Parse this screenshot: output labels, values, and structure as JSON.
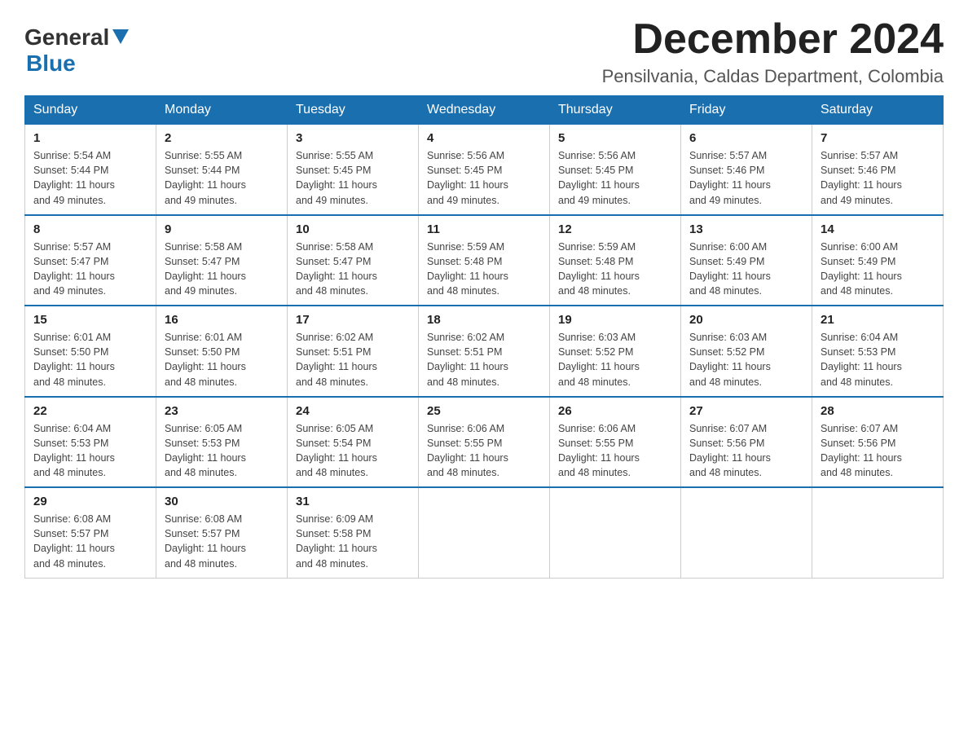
{
  "header": {
    "logo_general": "General",
    "logo_blue": "Blue",
    "title": "December 2024",
    "subtitle": "Pensilvania, Caldas Department, Colombia"
  },
  "days_of_week": [
    "Sunday",
    "Monday",
    "Tuesday",
    "Wednesday",
    "Thursday",
    "Friday",
    "Saturday"
  ],
  "weeks": [
    [
      {
        "day": "1",
        "sunrise": "5:54 AM",
        "sunset": "5:44 PM",
        "daylight": "11 hours and 49 minutes."
      },
      {
        "day": "2",
        "sunrise": "5:55 AM",
        "sunset": "5:44 PM",
        "daylight": "11 hours and 49 minutes."
      },
      {
        "day": "3",
        "sunrise": "5:55 AM",
        "sunset": "5:45 PM",
        "daylight": "11 hours and 49 minutes."
      },
      {
        "day": "4",
        "sunrise": "5:56 AM",
        "sunset": "5:45 PM",
        "daylight": "11 hours and 49 minutes."
      },
      {
        "day": "5",
        "sunrise": "5:56 AM",
        "sunset": "5:45 PM",
        "daylight": "11 hours and 49 minutes."
      },
      {
        "day": "6",
        "sunrise": "5:57 AM",
        "sunset": "5:46 PM",
        "daylight": "11 hours and 49 minutes."
      },
      {
        "day": "7",
        "sunrise": "5:57 AM",
        "sunset": "5:46 PM",
        "daylight": "11 hours and 49 minutes."
      }
    ],
    [
      {
        "day": "8",
        "sunrise": "5:57 AM",
        "sunset": "5:47 PM",
        "daylight": "11 hours and 49 minutes."
      },
      {
        "day": "9",
        "sunrise": "5:58 AM",
        "sunset": "5:47 PM",
        "daylight": "11 hours and 49 minutes."
      },
      {
        "day": "10",
        "sunrise": "5:58 AM",
        "sunset": "5:47 PM",
        "daylight": "11 hours and 48 minutes."
      },
      {
        "day": "11",
        "sunrise": "5:59 AM",
        "sunset": "5:48 PM",
        "daylight": "11 hours and 48 minutes."
      },
      {
        "day": "12",
        "sunrise": "5:59 AM",
        "sunset": "5:48 PM",
        "daylight": "11 hours and 48 minutes."
      },
      {
        "day": "13",
        "sunrise": "6:00 AM",
        "sunset": "5:49 PM",
        "daylight": "11 hours and 48 minutes."
      },
      {
        "day": "14",
        "sunrise": "6:00 AM",
        "sunset": "5:49 PM",
        "daylight": "11 hours and 48 minutes."
      }
    ],
    [
      {
        "day": "15",
        "sunrise": "6:01 AM",
        "sunset": "5:50 PM",
        "daylight": "11 hours and 48 minutes."
      },
      {
        "day": "16",
        "sunrise": "6:01 AM",
        "sunset": "5:50 PM",
        "daylight": "11 hours and 48 minutes."
      },
      {
        "day": "17",
        "sunrise": "6:02 AM",
        "sunset": "5:51 PM",
        "daylight": "11 hours and 48 minutes."
      },
      {
        "day": "18",
        "sunrise": "6:02 AM",
        "sunset": "5:51 PM",
        "daylight": "11 hours and 48 minutes."
      },
      {
        "day": "19",
        "sunrise": "6:03 AM",
        "sunset": "5:52 PM",
        "daylight": "11 hours and 48 minutes."
      },
      {
        "day": "20",
        "sunrise": "6:03 AM",
        "sunset": "5:52 PM",
        "daylight": "11 hours and 48 minutes."
      },
      {
        "day": "21",
        "sunrise": "6:04 AM",
        "sunset": "5:53 PM",
        "daylight": "11 hours and 48 minutes."
      }
    ],
    [
      {
        "day": "22",
        "sunrise": "6:04 AM",
        "sunset": "5:53 PM",
        "daylight": "11 hours and 48 minutes."
      },
      {
        "day": "23",
        "sunrise": "6:05 AM",
        "sunset": "5:53 PM",
        "daylight": "11 hours and 48 minutes."
      },
      {
        "day": "24",
        "sunrise": "6:05 AM",
        "sunset": "5:54 PM",
        "daylight": "11 hours and 48 minutes."
      },
      {
        "day": "25",
        "sunrise": "6:06 AM",
        "sunset": "5:55 PM",
        "daylight": "11 hours and 48 minutes."
      },
      {
        "day": "26",
        "sunrise": "6:06 AM",
        "sunset": "5:55 PM",
        "daylight": "11 hours and 48 minutes."
      },
      {
        "day": "27",
        "sunrise": "6:07 AM",
        "sunset": "5:56 PM",
        "daylight": "11 hours and 48 minutes."
      },
      {
        "day": "28",
        "sunrise": "6:07 AM",
        "sunset": "5:56 PM",
        "daylight": "11 hours and 48 minutes."
      }
    ],
    [
      {
        "day": "29",
        "sunrise": "6:08 AM",
        "sunset": "5:57 PM",
        "daylight": "11 hours and 48 minutes."
      },
      {
        "day": "30",
        "sunrise": "6:08 AM",
        "sunset": "5:57 PM",
        "daylight": "11 hours and 48 minutes."
      },
      {
        "day": "31",
        "sunrise": "6:09 AM",
        "sunset": "5:58 PM",
        "daylight": "11 hours and 48 minutes."
      },
      null,
      null,
      null,
      null
    ]
  ],
  "labels": {
    "sunrise": "Sunrise:",
    "sunset": "Sunset:",
    "daylight": "Daylight:"
  }
}
